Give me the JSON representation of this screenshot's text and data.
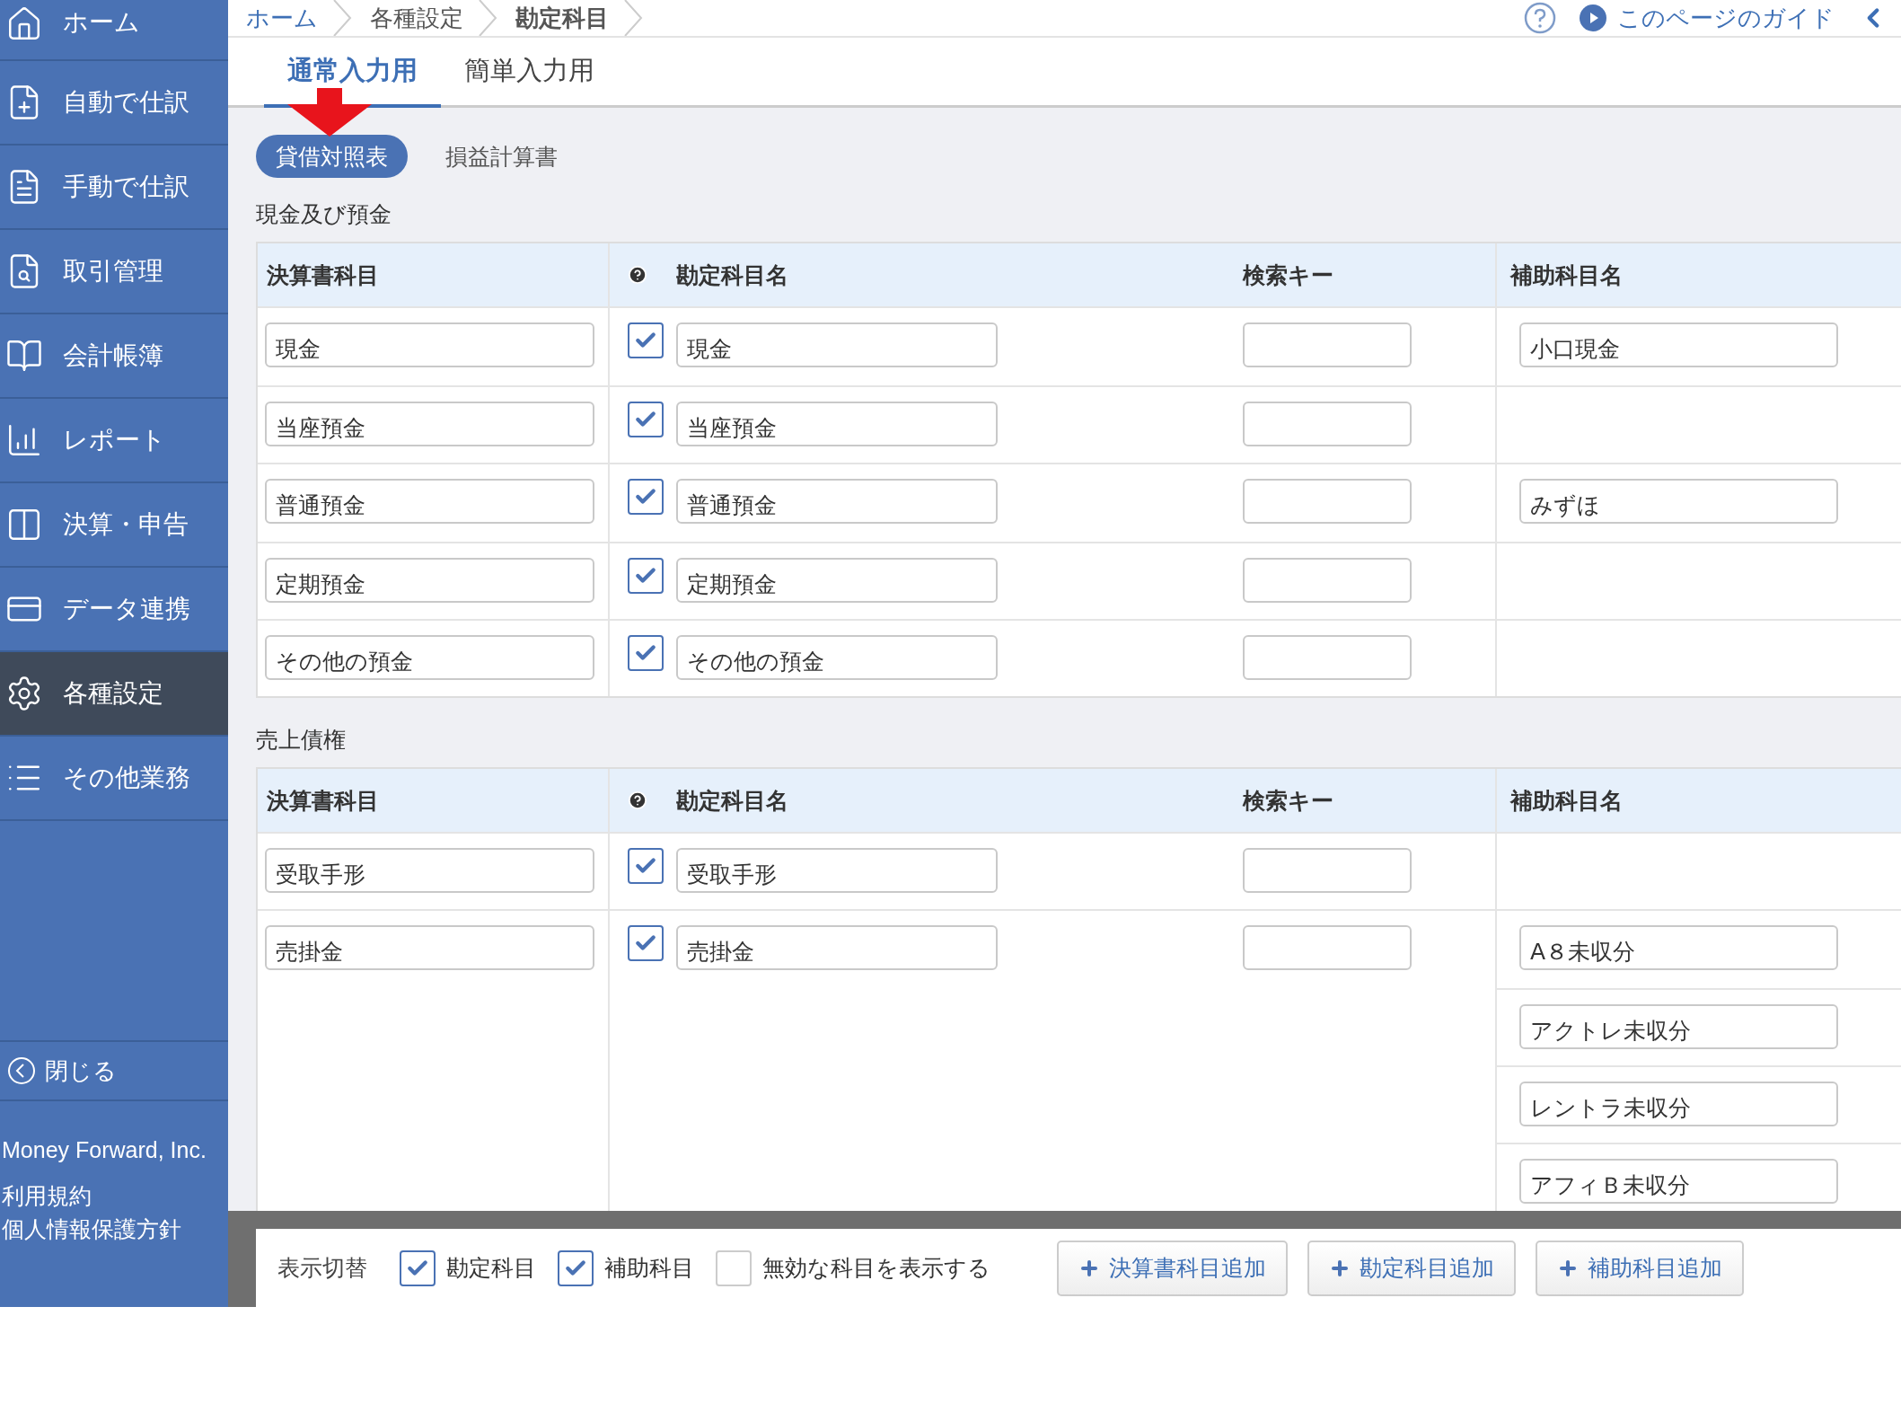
{
  "sidebar": {
    "items": [
      {
        "label": "ホーム",
        "selected": false
      },
      {
        "label": "自動で仕訳",
        "selected": false
      },
      {
        "label": "手動で仕訳",
        "selected": false
      },
      {
        "label": "取引管理",
        "selected": false
      },
      {
        "label": "会計帳簿",
        "selected": false
      },
      {
        "label": "レポート",
        "selected": false
      },
      {
        "label": "決算・申告",
        "selected": false
      },
      {
        "label": "データ連携",
        "selected": false
      },
      {
        "label": "各種設定",
        "selected": true
      },
      {
        "label": "その他業務",
        "selected": false
      }
    ],
    "close": "閉じる",
    "company": "Money Forward, Inc.",
    "links": [
      "利用規約",
      "個人情報保護方針"
    ]
  },
  "breadcrumb": [
    {
      "label": "ホーム",
      "kind": "link"
    },
    {
      "label": "各種設定",
      "kind": "plain"
    },
    {
      "label": "勘定科目",
      "kind": "current"
    }
  ],
  "guide_link": "このページのガイド",
  "tabs": [
    {
      "label": "通常入力用",
      "selected": true
    },
    {
      "label": "簡単入力用",
      "selected": false
    }
  ],
  "statement_tabs": [
    {
      "label": "貸借対照表",
      "selected": true
    },
    {
      "label": "損益計算書",
      "selected": false
    }
  ],
  "sections": [
    {
      "title": "現金及び預金",
      "columns": [
        "決算書科目",
        "勘定科目名",
        "検索キー",
        "補助科目名"
      ],
      "rows": [
        {
          "statement_item": "現金",
          "checked": true,
          "account": "現金",
          "sub_accounts": [
            "小口現金"
          ]
        },
        {
          "statement_item": "当座預金",
          "checked": true,
          "account": "当座預金"
        },
        {
          "statement_item": "普通預金",
          "checked": true,
          "account": "普通預金",
          "sub_accounts": [
            "みずほ"
          ]
        },
        {
          "statement_item": "定期預金",
          "checked": true,
          "account": "定期預金"
        },
        {
          "statement_item": "その他の預金",
          "checked": true,
          "account": "その他の預金"
        }
      ]
    },
    {
      "title": "売上債権",
      "columns": [
        "決算書科目",
        "勘定科目名",
        "検索キー",
        "補助科目名"
      ],
      "rows": [
        {
          "statement_item": "受取手形",
          "checked": true,
          "account": "受取手形"
        },
        {
          "statement_item": "売掛金",
          "checked": true,
          "account": "売掛金",
          "sub_accounts": [
            "A８未収分",
            "アクトレ未収分",
            "レントラ未収分",
            "アフィＢ未収分"
          ]
        }
      ]
    }
  ],
  "footer": {
    "label": "表示切替",
    "toggles": [
      {
        "label": "勘定科目",
        "checked": true
      },
      {
        "label": "補助科目",
        "checked": true
      },
      {
        "label": "無効な科目を表示する",
        "checked": false
      }
    ],
    "buttons": [
      "決算書科目追加",
      "勘定科目追加",
      "補助科目追加"
    ]
  }
}
